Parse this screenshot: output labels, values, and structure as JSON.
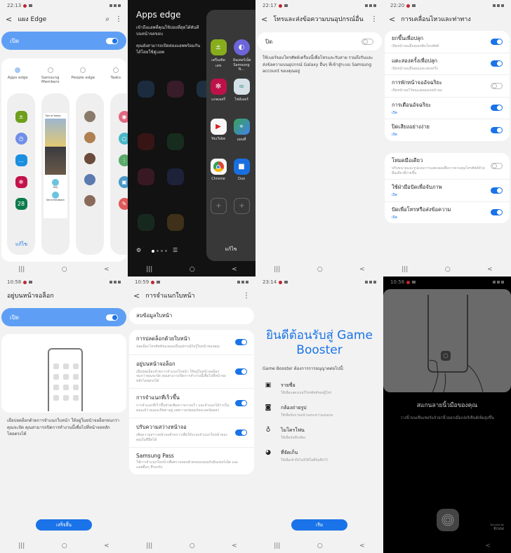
{
  "panels": {
    "edge_panels": {
      "time": "22:13",
      "title": "แผง Edge",
      "master_label": "เปิด",
      "master_on": true,
      "options": [
        {
          "label": "Apps edge",
          "selected": true
        },
        {
          "label": "Samsung Members",
          "selected": false
        },
        {
          "label": "People edge",
          "selected": false
        },
        {
          "label": "Tasks",
          "selected": false
        }
      ],
      "members_preview": {
        "tips": "Tips of today",
        "faq": "FAQ",
        "feedback": "Send feedback"
      },
      "edit_label": "แก้ไข"
    },
    "apps_edge": {
      "title": "Apps edge",
      "desc1": "เข้าถึงแอพที่คุณใช้บ่อยที่สุดได้ทันทีบนหน้าจอขอบ",
      "desc2": "คุณยังสามารถเปิดสองแอพพร้อมกันได้โดยใช้คู่แอพ",
      "apps": [
        {
          "label": "เครื่องคิดเลข",
          "icon": "calculator-icon",
          "color": "#8bb31d"
        },
        {
          "label": "อินเทอร์เน็ต Samsung N...",
          "icon": "samsung-internet-icon",
          "color": "#6f68e0"
        },
        {
          "label": "แกลเลอรี่",
          "icon": "gallery-icon",
          "color": "#c3134b"
        },
        {
          "label": "ไฟล์เลอร์",
          "icon": "files-icon",
          "color": "#dde8ee"
        },
        {
          "label": "YouTube",
          "icon": "youtube-icon",
          "color": "#ffffff"
        },
        {
          "label": "แผนที่",
          "icon": "maps-icon",
          "color": "#3aa757"
        },
        {
          "label": "Chrome",
          "icon": "chrome-icon",
          "color": "#ffffff"
        },
        {
          "label": "Duo",
          "icon": "duo-icon",
          "color": "#1a73e8"
        }
      ],
      "edit_label": "แก้ไข"
    },
    "calls_other_devices": {
      "time": "22:17",
      "title": "โทรและส่งข้อความบนอุปกรณ์อื่น",
      "master_label": "ปิด",
      "master_on": false,
      "description": "ใช้เบอร์ของโทรศัพท์เครื่องนี้เพื่อโทรและรับสาย รวมถึงรับและส่งข้อความบนอุปกรณ์ Galaxy อื่นๆ ที่เข้าสู่ระบบ Samsung account ของคุณอยู่"
    },
    "motions": {
      "time": "22:20",
      "title": "การเคลื่อนไหวและท่าทาง",
      "group1": [
        {
          "title": "ยกขึ้นเพื่อปลุก",
          "sub": "เปิดหน้าจอเมื่อคุณหยิบโทรศัพท์",
          "on": true,
          "sub_blue": false
        },
        {
          "title": "แตะสองครั้งเพื่อปลุก",
          "sub": "เปิดหน้าจอเมื่อคุณแตะสองครั้ง",
          "on": true,
          "sub_blue": false
        },
        {
          "title": "การพักหน้าจออัจฉริยะ",
          "sub": "เปิดหน้าจอไว้ขณะคุณมองหน้าจอ",
          "on": false,
          "sub_blue": false
        },
        {
          "title": "การเตือนอัจฉริยะ",
          "sub": "เปิด",
          "on": true,
          "sub_blue": true
        },
        {
          "title": "ปิดเสียงอย่างง่าย",
          "sub": "เปิด",
          "on": true,
          "sub_blue": true
        }
      ],
      "group2": [
        {
          "title": "โหมดมือเดียว",
          "sub": "ปรับขนาดและรูปแบบการแสดงผลเพื่อการควบคุมโทรศัพท์ด้วยมือเดียวที่ง่ายขึ้น",
          "on": false,
          "sub_blue": false
        },
        {
          "title": "ใช้ฝ่ามือปัดเพื่อจับภาพ",
          "sub": "เปิด",
          "on": true,
          "sub_blue": true
        },
        {
          "title": "ปัดเพื่อโทรหรือส่งข้อความ",
          "sub": "เปิด",
          "on": true,
          "sub_blue": true
        }
      ]
    },
    "stay_on_lock": {
      "time": "10:58",
      "title": "อยู่บนหน้าจอล็อก",
      "master_label": "เปิด",
      "master_on": true,
      "description": "เมื่อปลดล็อกด้วยการจำแนกใบหน้า ให้อยู่ในหน้าจอล็อกจนกว่าคุณจะปัด คุณสามารถปิดการทำงานนี้เพื่อไปที่หน้าจอหลักโดยตรงได้",
      "button": "เสร็จสิ้น"
    },
    "face_recognition": {
      "time": "10:59",
      "title": "การจำแนกใบหน้า",
      "remove_label": "ลบข้อมูลใบหน้า",
      "items": [
        {
          "title": "การปลดล็อกด้วยใบหน้า",
          "sub": "ปลดล็อกโทรศัพท์ของคุณเมื่ออุปกรณ์รับรู้ใบหน้าของคุณ",
          "toggle": true,
          "on": true
        },
        {
          "title": "อยู่บนหน้าจอล็อก",
          "sub": "เมื่อปลดล็อกด้วยการจำแนกใบหน้า ให้อยู่ในหน้าจอล็อกจนกว่าคุณจะปัด คุณสามารถปิดการทำงานนี้เพื่อไปที่หน้าจอหลักโดยตรงได้",
          "toggle": true,
          "on": true
        },
        {
          "title": "การจำแนกที่เร็วขึ้น",
          "sub": "การจำแนกที่เร็วขึ้นช่วยเพิ่มความรวดเร็ว และจำแนกได้ว่าเป็นคุณแม้ว่าคุณจะปิดตาอยู่ แต่ความปลอดภัยจะลดน้อยลง",
          "toggle": true,
          "on": true
        },
        {
          "title": "ปรับความสว่างหน้าจอ",
          "sub": "เพิ่มความสว่างหน้าจอชั่วคราวเพื่อให้ระบบจำแนกใบหน้าของคุณในที่มืดได้",
          "toggle": true,
          "on": true
        },
        {
          "title": "Samsung Pass",
          "sub": "ใช้การจำแนกใบหน้าเพื่อตรวจสอบตัวตนของคุณกับอินเทอร์เน็ต และแอพอื่นๆ ที่รองรับ",
          "toggle": false,
          "on": false
        }
      ]
    },
    "game_booster": {
      "time": "23:14",
      "title": "ยินดีต้อนรับสู่ Game Booster",
      "subtitle": "Game Booster ต้องการการอนุญาตต่อไปนี้:",
      "permissions": [
        {
          "title": "รายชื่อ",
          "sub": "ใช้เพื่อแสดงเบอร์โทรศัพท์ของผู้โทร",
          "icon": "contacts-icon",
          "glyph": "👤"
        },
        {
          "title": "กล้องถ่ายรูป",
          "sub": "ใช้เพื่อจับภาพหน้าจอระหว่างเล่นเกม",
          "icon": "camera-icon",
          "glyph": "📷"
        },
        {
          "title": "ไมโครโฟน",
          "sub": "ใช้เพื่อบันทึกเสียง",
          "icon": "microphone-icon",
          "glyph": "🎤"
        },
        {
          "title": "ที่จัดเก็บ",
          "sub": "ใช้เพื่อเข้าถึงไฟล์วิดีโอที่บันทึกไว้",
          "icon": "storage-icon",
          "glyph": "◕"
        }
      ],
      "button": "เริ่ม"
    },
    "fingerprint": {
      "time": "10:56",
      "title": "สแกนลายนิ้วมือของคุณ",
      "description": "วางนิ้วบนเซ็นเซอร์แล้วยกนิ้วออกเมื่อเปอร์เซ็นต์เพิ่มสูงขึ้น",
      "knox_label": "Knox",
      "knox_sub": "Secured by"
    }
  },
  "navbar": {
    "recent": "|||",
    "home": "○",
    "back": "<"
  }
}
